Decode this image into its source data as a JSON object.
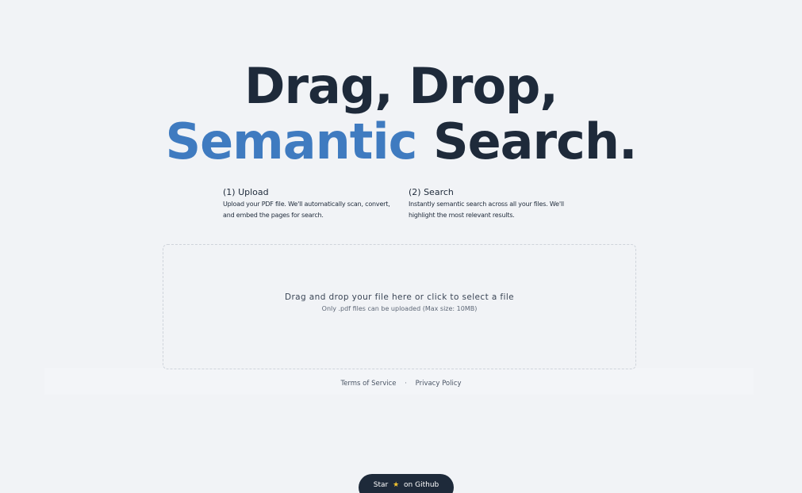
{
  "hero": {
    "line1": "Drag, Drop,",
    "accent": "Semantic",
    "line2_rest": " Search."
  },
  "steps": [
    {
      "title": "(1) Upload",
      "desc_line1": "Upload your PDF file. We'll automatically scan, convert,",
      "desc_line2": "and embed the pages for search."
    },
    {
      "title": "(2) Search",
      "desc_line1": "Instantly semantic search across all your files. We'll",
      "desc_line2": "highlight the most relevant results."
    }
  ],
  "dropzone": {
    "main_text": "Drag and drop your file here or click to select a file",
    "sub_text": "Only .pdf files can be uploaded (Max size: 10MB)"
  },
  "footer": {
    "terms": "Terms of Service",
    "separator": "·",
    "privacy": "Privacy Policy"
  },
  "github_button": {
    "prefix": "Star",
    "icon": "star-icon",
    "suffix": "on Github"
  },
  "colors": {
    "background": "#f1f3f6",
    "text": "#1e2a3a",
    "accent": "#3f7bc0",
    "star": "#f4c430"
  }
}
